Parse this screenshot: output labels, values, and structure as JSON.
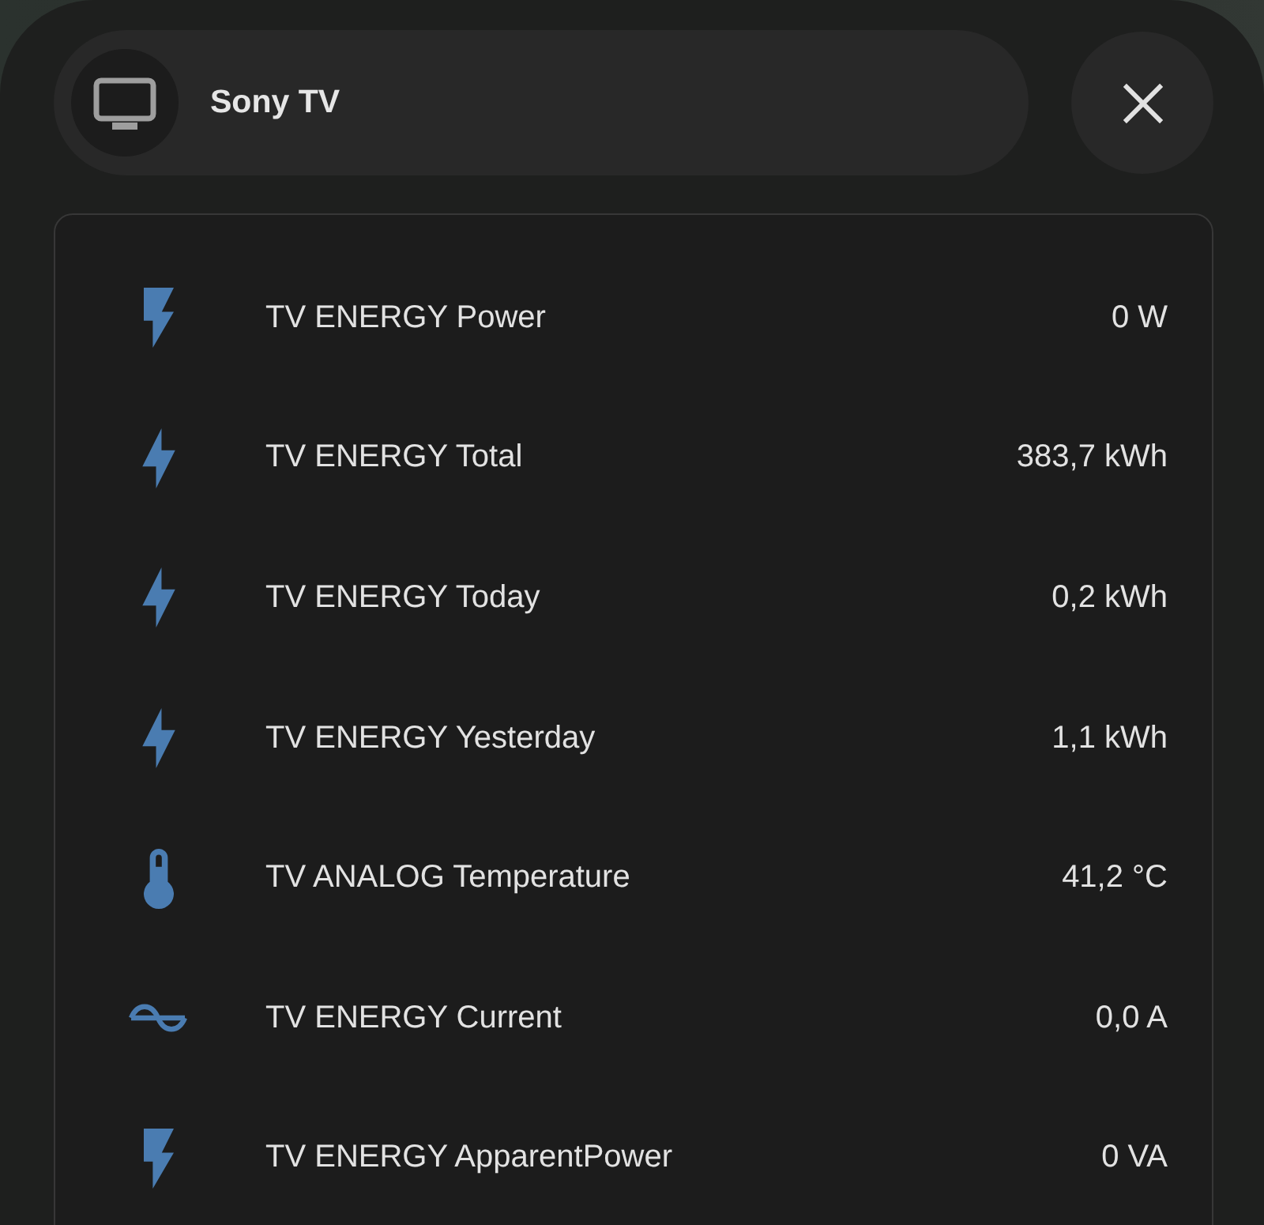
{
  "header": {
    "title": "Sony TV"
  },
  "entities": [
    {
      "kind": "power",
      "name": "TV ENERGY Power",
      "value": "0 W"
    },
    {
      "kind": "energy",
      "name": "TV ENERGY Total",
      "value": "383,7 kWh"
    },
    {
      "kind": "energy",
      "name": "TV ENERGY Today",
      "value": "0,2 kWh"
    },
    {
      "kind": "energy",
      "name": "TV ENERGY Yesterday",
      "value": "1,1 kWh"
    },
    {
      "kind": "temperature",
      "name": "TV ANALOG Temperature",
      "value": "41,2 °C"
    },
    {
      "kind": "current",
      "name": "TV ENERGY Current",
      "value": "0,0 A"
    },
    {
      "kind": "power",
      "name": "TV ENERGY ApparentPower",
      "value": "0 VA"
    }
  ]
}
